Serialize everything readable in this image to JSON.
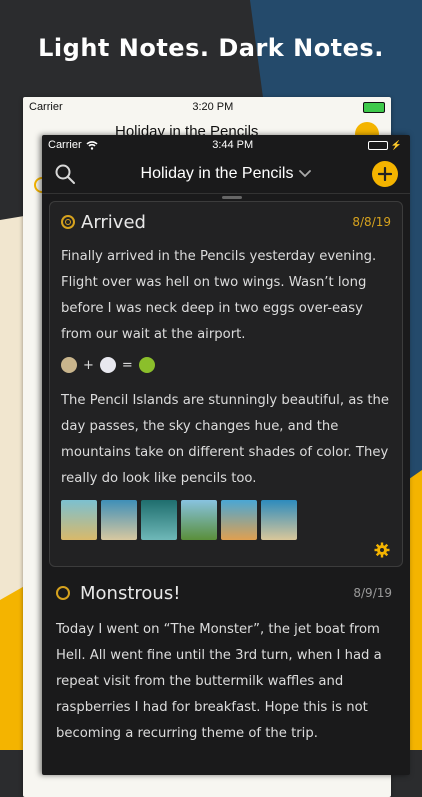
{
  "headline": "Light Notes. Dark Notes.",
  "light_phone": {
    "carrier": "Carrier",
    "time": "3:20 PM",
    "title": "Holiday in the Pencils"
  },
  "dark_phone": {
    "carrier": "Carrier",
    "time": "3:44 PM",
    "title": "Holiday in the Pencils",
    "entries": [
      {
        "title": "Arrived",
        "date": "8/8/19",
        "para1": "Finally arrived in the Pencils yesterday evening. Flight over was hell on two wings. Wasn’t long before I was neck deep in two eggs over-easy from our wait at the airport.",
        "emoji_plus": "+",
        "emoji_equals": "=",
        "para2": "The Pencil Islands are stunningly beautiful, as the day passes, the sky changes hue, and the mountains take on different shades of color. They really do look like pencils too."
      },
      {
        "title": "Monstrous!",
        "date": "8/9/19",
        "para1": "Today I went on “The Monster”, the jet boat from Hell. All went fine until the 3rd turn, when I had a repeat visit from the buttermilk waffles and raspberries I had for breakfast. Hope this is not becoming a recurring theme of the trip."
      }
    ]
  },
  "colors": {
    "accent": "#f4b400",
    "date_accent": "#d6a21e",
    "dark_bg": "#1a1a1b"
  },
  "icons": [
    "search-icon",
    "chevron-down-icon",
    "add-icon",
    "gear-icon",
    "wifi-icon",
    "battery-icon"
  ]
}
